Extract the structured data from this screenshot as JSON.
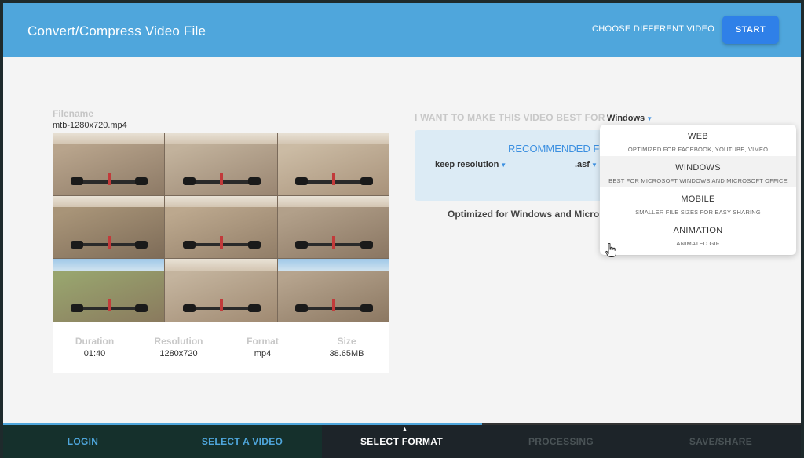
{
  "header": {
    "title": "Convert/Compress Video File",
    "choose_label": "CHOOSE DIFFERENT VIDEO",
    "start_label": "START",
    "colors": {
      "header_bg": "#4fa6dc",
      "start_bg": "#2f80e8"
    }
  },
  "file": {
    "label": "Filename",
    "name": "mtb-1280x720.mp4",
    "info": [
      {
        "label": "Duration",
        "value": "01:40"
      },
      {
        "label": "Resolution",
        "value": "1280x720"
      },
      {
        "label": "Format",
        "value": "mp4"
      },
      {
        "label": "Size",
        "value": "38.65MB"
      }
    ]
  },
  "config": {
    "best_for_label": "I WANT TO MAKE THIS VIDEO BEST FOR",
    "best_for_value": "Windows",
    "recommended_title": "RECOMMENDED FOR",
    "resolution_value": "keep resolution",
    "format_value": ".asf",
    "optimized_text": "Optimized for Windows and Microsoft Office"
  },
  "dropdown": {
    "items": [
      {
        "title": "WEB",
        "subtitle": "OPTIMIZED FOR FACEBOOK, YOUTUBE, VIMEO"
      },
      {
        "title": "WINDOWS",
        "subtitle": "BEST FOR MICROSOFT WINDOWS AND MICROSOFT OFFICE"
      },
      {
        "title": "MOBILE",
        "subtitle": "SMALLER FILE SIZES FOR EASY SHARING"
      },
      {
        "title": "ANIMATION",
        "subtitle": "ANIMATED GIF"
      }
    ],
    "hovered_index": 1
  },
  "steps": {
    "items": [
      {
        "label": "LOGIN",
        "state": "done"
      },
      {
        "label": "SELECT A VIDEO",
        "state": "done"
      },
      {
        "label": "SELECT FORMAT",
        "state": "active"
      },
      {
        "label": "PROCESSING",
        "state": "todo"
      },
      {
        "label": "SAVE/SHARE",
        "state": "todo"
      }
    ],
    "progress_fraction": 0.6
  },
  "icons": {
    "caret": "caret-down-icon",
    "cursor": "hand-pointer-icon",
    "step_marker": "caret-up-icon"
  }
}
